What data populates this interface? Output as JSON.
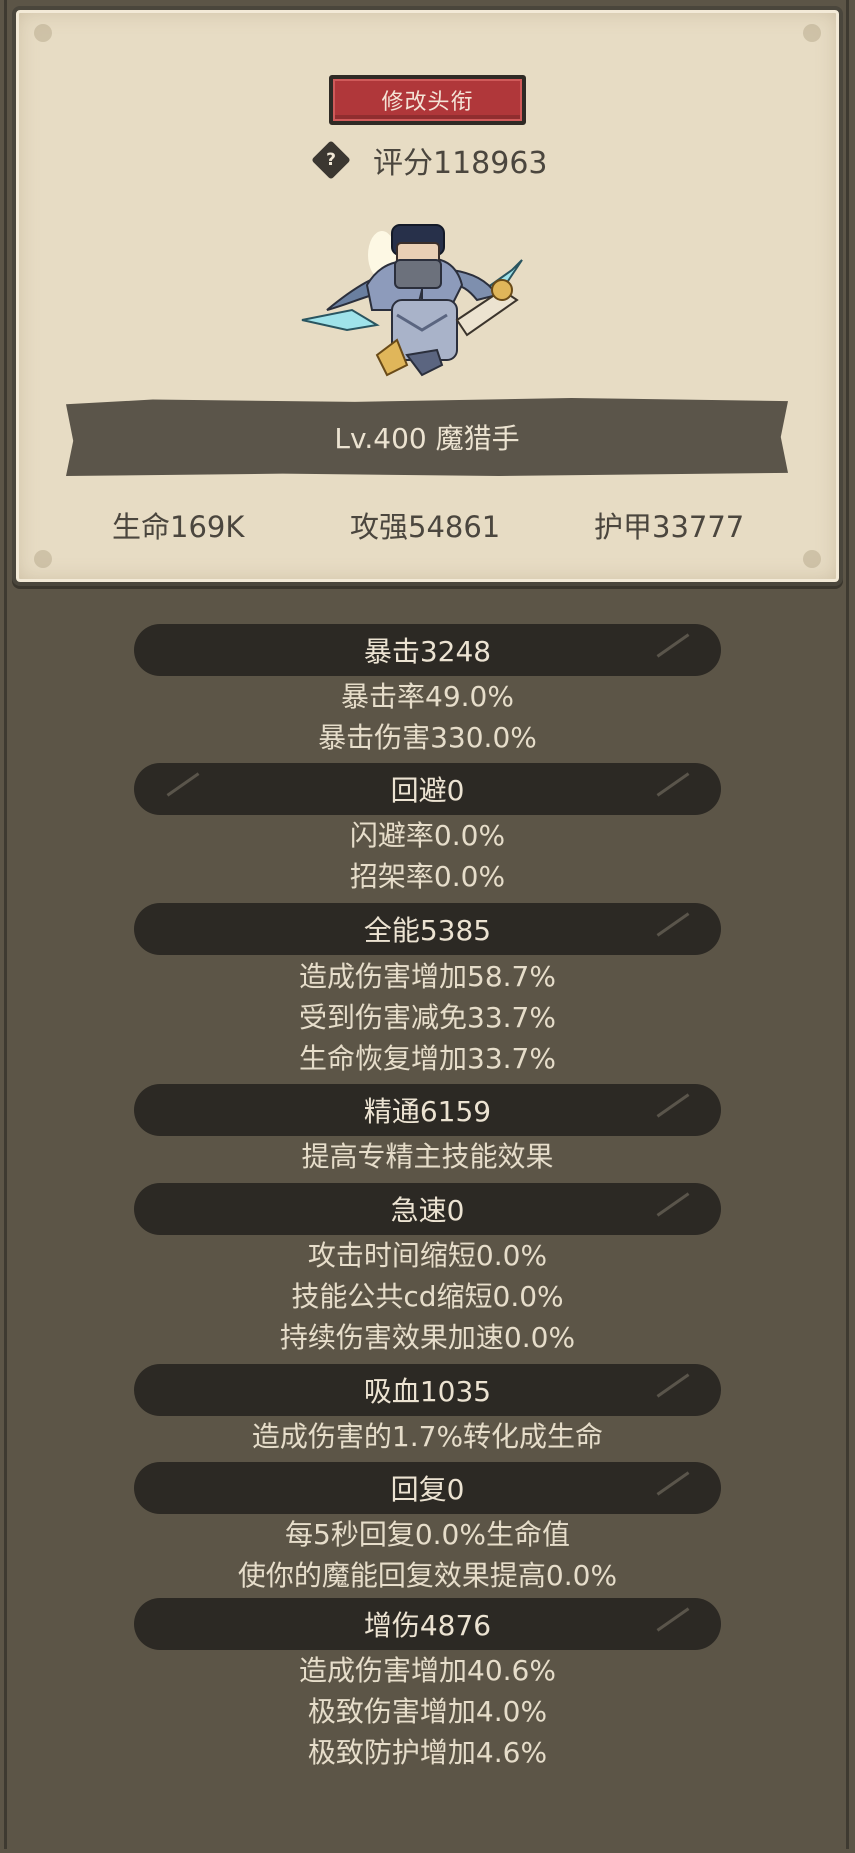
{
  "profile": {
    "title_button": "修改头衔",
    "help_icon": "question-diamond-icon",
    "score": "评分118963",
    "character_name": "Lv.400 魔猎手",
    "stats": {
      "life": "生命169K",
      "attack": "攻强54861",
      "armor": "护甲33777"
    }
  },
  "sections": {
    "crit": {
      "header": "暴击3248",
      "lines": [
        "暴击率49.0%",
        "暴击伤害330.0%"
      ]
    },
    "dodge": {
      "header": "回避0",
      "lines": [
        "闪避率0.0%",
        "招架率0.0%"
      ]
    },
    "versatility": {
      "header": "全能5385",
      "lines": [
        "造成伤害增加58.7%",
        "受到伤害减免33.7%",
        "生命恢复增加33.7%"
      ]
    },
    "mastery": {
      "header": "精通6159",
      "lines": [
        "提高专精主技能效果"
      ]
    },
    "haste": {
      "header": "急速0",
      "lines": [
        "攻击时间缩短0.0%",
        "技能公共cd缩短0.0%",
        "持续伤害效果加速0.0%"
      ]
    },
    "leech": {
      "header": "吸血1035",
      "lines": [
        "造成伤害的1.7%转化成生命"
      ]
    },
    "regen": {
      "header": "回复0",
      "lines": [
        "每5秒回复0.0%生命值",
        "使你的魔能回复效果提高0.0%"
      ]
    },
    "damage_boost": {
      "header": "增伤4876",
      "lines": [
        "造成伤害增加40.6%",
        "极致伤害增加4.0%",
        "极致防护增加4.6%"
      ]
    }
  },
  "colors": {
    "background": "#5c5547",
    "parchment": "#e7dcc4",
    "title_button": "#b0373a",
    "section_header": "#2c2924",
    "text_light": "#e6ddca",
    "text_dark": "#4b463e"
  }
}
